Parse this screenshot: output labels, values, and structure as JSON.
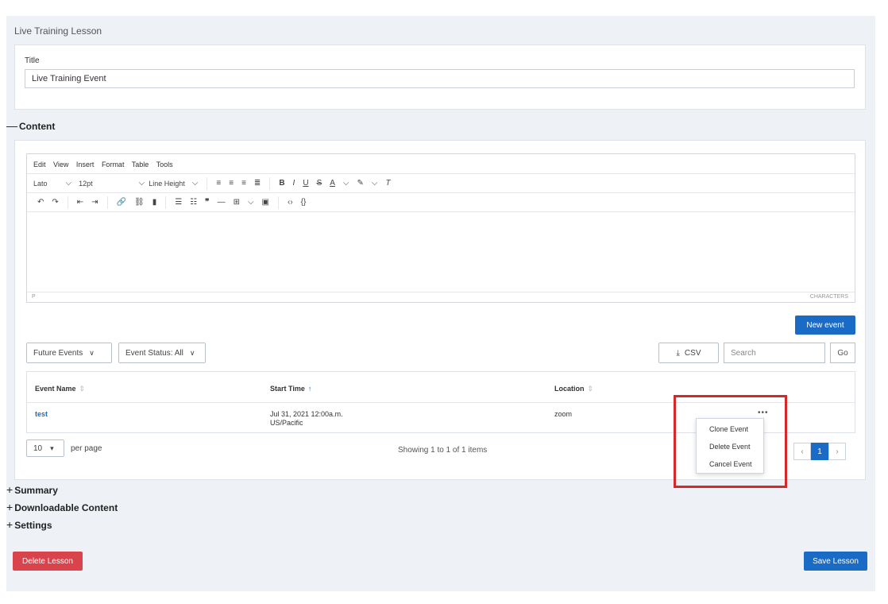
{
  "page": {
    "header_title": "Live Training Lesson"
  },
  "title_section": {
    "label": "Title",
    "value": "Live Training Event"
  },
  "sections": {
    "content": "Content",
    "summary": "Summary",
    "downloadable": "Downloadable Content",
    "settings": "Settings"
  },
  "editor": {
    "menus": [
      "Edit",
      "View",
      "Insert",
      "Format",
      "Table",
      "Tools"
    ],
    "font": "Lato",
    "font_size": "12pt",
    "line_height": "Line Height",
    "status_path": "P",
    "status_chars": "CHARACTERS"
  },
  "events": {
    "new_event_label": "New event",
    "filter_time": "Future Events",
    "filter_status": "Event Status: All",
    "csv_label": "CSV",
    "search_placeholder": "Search",
    "go_label": "Go",
    "columns": {
      "name": "Event Name",
      "start": "Start Time",
      "location": "Location"
    },
    "rows": [
      {
        "name": "test",
        "start_date": "Jul 31, 2021 12:00a.m.",
        "timezone": "US/Pacific",
        "location": "zoom"
      }
    ],
    "row_menu_icon": "•••",
    "per_page_value": "10",
    "per_page_label": "per page",
    "showing_text": "Showing 1 to 1 of 1 items",
    "current_page": "1"
  },
  "row_menu": {
    "items": [
      "Clone Event",
      "Delete Event",
      "Cancel Event"
    ]
  },
  "footer": {
    "delete_label": "Delete Lesson",
    "save_label": "Save Lesson"
  },
  "colors": {
    "primary": "#1a6bc6",
    "danger": "#d9434b",
    "highlight": "#d62828",
    "panel_bg": "#eef1f5"
  }
}
